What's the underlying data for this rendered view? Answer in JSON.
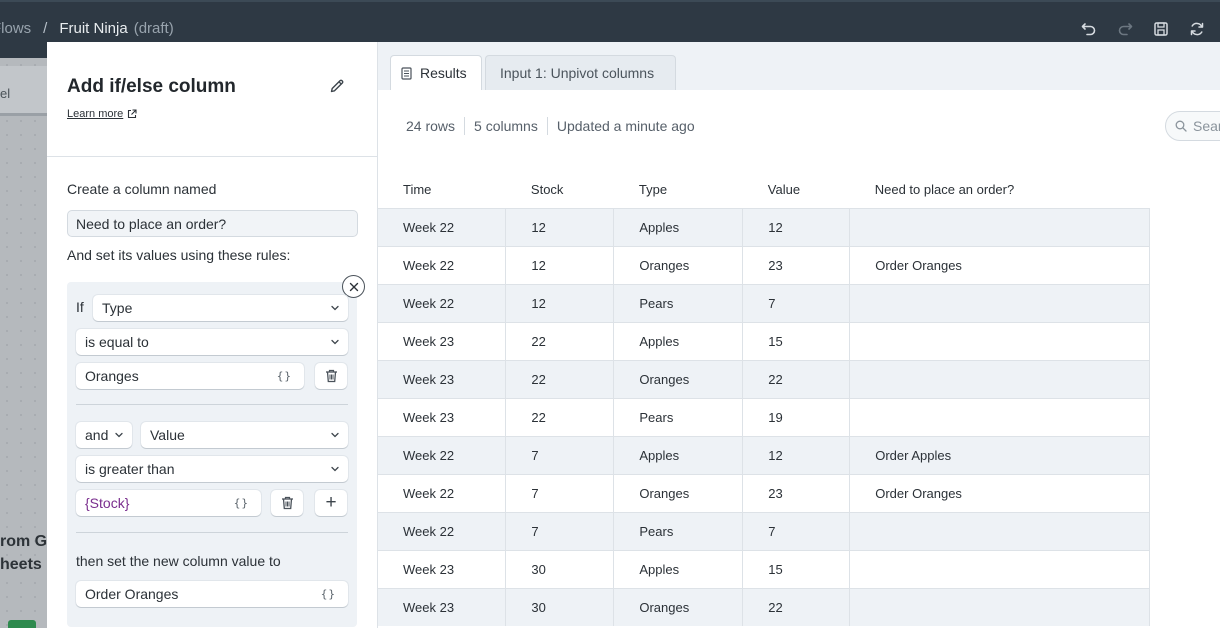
{
  "topbar": {
    "breadcrumb_root": "Flows",
    "breadcrumb_sep": "/",
    "project_name": "Fruit Ninja",
    "status": "(draft)"
  },
  "background": {
    "tab_fragment": "el",
    "step_text_line1": "rom Go",
    "step_text_line2": "heets"
  },
  "panel": {
    "title": "Add if/else column",
    "learn_more": "Learn more",
    "column_named_label": "Create a column named",
    "column_name_value": "Need to place an order?",
    "rules_label": "And set its values using these rules:",
    "if_label": "If",
    "condition1": {
      "column": "Type",
      "operator": "is equal to",
      "value": "Oranges"
    },
    "condition2": {
      "joiner": "and",
      "column": "Value",
      "operator": "is greater than",
      "value": "{Stock}"
    },
    "then_label": "then set the new column value to",
    "then_value": "Order Oranges",
    "brace_glyph": "{}",
    "add_glyph": "+"
  },
  "tabs": [
    {
      "label": "Results"
    },
    {
      "label": "Input 1: Unpivot columns"
    }
  ],
  "meta": {
    "rows": "24 rows",
    "columns": "5 columns",
    "updated": "Updated a minute ago",
    "search_placeholder": "Search"
  },
  "table": {
    "headers": [
      "Time",
      "Stock",
      "Type",
      "Value",
      "Need to place an order?"
    ],
    "rows": [
      [
        "Week 22",
        "12",
        "Apples",
        "12",
        ""
      ],
      [
        "Week 22",
        "12",
        "Oranges",
        "23",
        "Order Oranges"
      ],
      [
        "Week 22",
        "12",
        "Pears",
        "7",
        ""
      ],
      [
        "Week 23",
        "22",
        "Apples",
        "15",
        ""
      ],
      [
        "Week 23",
        "22",
        "Oranges",
        "22",
        ""
      ],
      [
        "Week 23",
        "22",
        "Pears",
        "19",
        ""
      ],
      [
        "Week 22",
        "7",
        "Apples",
        "12",
        "Order Apples"
      ],
      [
        "Week 22",
        "7",
        "Oranges",
        "23",
        "Order Oranges"
      ],
      [
        "Week 22",
        "7",
        "Pears",
        "7",
        ""
      ],
      [
        "Week 23",
        "30",
        "Apples",
        "15",
        ""
      ],
      [
        "Week 23",
        "30",
        "Oranges",
        "22",
        ""
      ]
    ]
  },
  "colors": {
    "topbar": "#2e3944",
    "row_alt": "#eef2f6",
    "variable": "#7a2e8e"
  }
}
